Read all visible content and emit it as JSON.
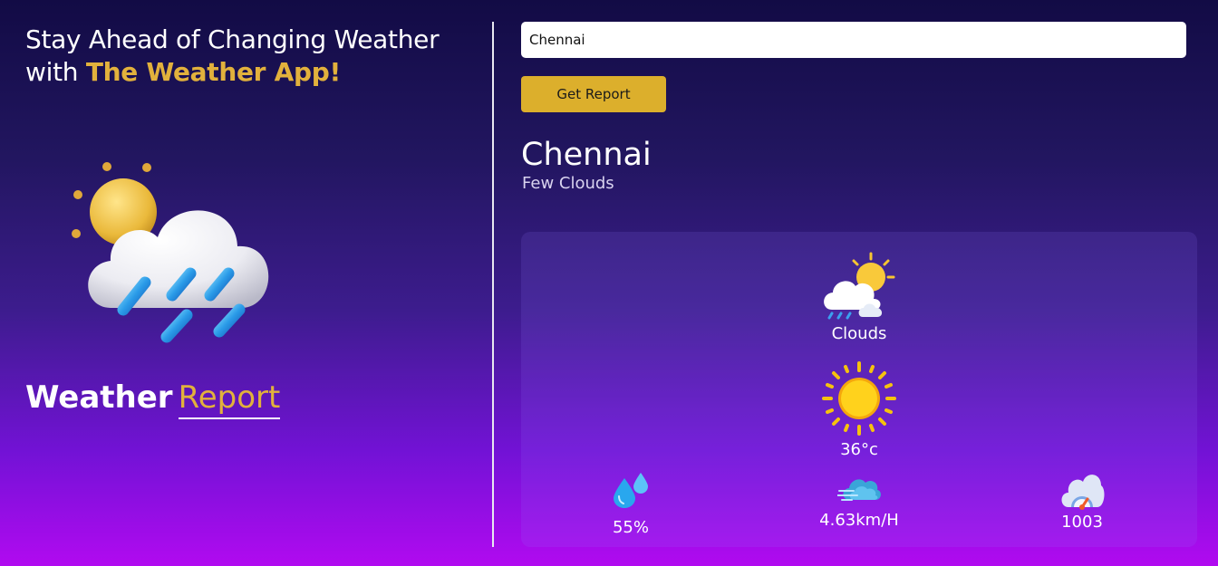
{
  "hero": {
    "headline_line1": "Stay Ahead of Changing Weather",
    "headline_prefix": "with ",
    "headline_brand": "The Weather App!",
    "report_title_main": "Weather",
    "report_title_accent": "Report",
    "icon": "sun-cloud-rain-icon"
  },
  "search": {
    "value": "Chennai",
    "button_label": "Get Report"
  },
  "result": {
    "city": "Chennai",
    "description": "Few Clouds",
    "condition": "Clouds",
    "condition_icon": "partly-cloudy-rain-icon",
    "temperature": "36°c",
    "temperature_icon": "sun-icon",
    "humidity": "55%",
    "humidity_icon": "water-drops-icon",
    "wind": "4.63km/H",
    "wind_icon": "wind-cloud-icon",
    "pressure": "1003",
    "pressure_icon": "pressure-gauge-cloud-icon"
  },
  "colors": {
    "accent": "#e2b13c",
    "button": "#dcaf2c",
    "bg_top": "#120b45",
    "bg_bottom": "#b10af0"
  }
}
